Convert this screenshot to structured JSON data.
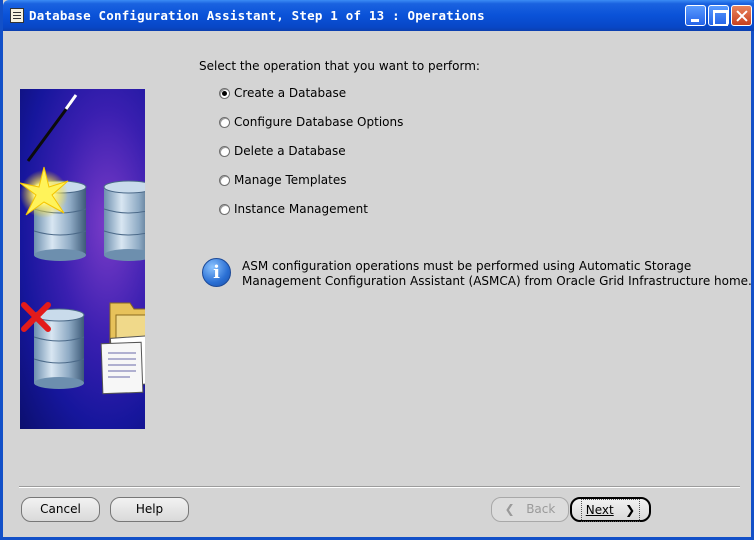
{
  "window": {
    "title": "Database Configuration Assistant, Step 1 of 13 : Operations"
  },
  "main": {
    "prompt": "Select the operation that you want to perform:",
    "options": [
      {
        "label": "Create a Database",
        "selected": true
      },
      {
        "label": "Configure Database Options",
        "selected": false
      },
      {
        "label": "Delete a Database",
        "selected": false
      },
      {
        "label": "Manage Templates",
        "selected": false
      },
      {
        "label": "Instance Management",
        "selected": false
      }
    ],
    "info_line1": "ASM configuration operations must be performed using Automatic Storage",
    "info_line2": "Management Configuration Assistant (ASMCA) from Oracle Grid Infrastructure home."
  },
  "buttons": {
    "cancel": "Cancel",
    "help": "Help",
    "back": "Back",
    "next": "Next"
  },
  "colors": {
    "titlebar": "#0a52d8",
    "window_bg": "#d4d4d4",
    "accent_check": "#d21d2a"
  }
}
